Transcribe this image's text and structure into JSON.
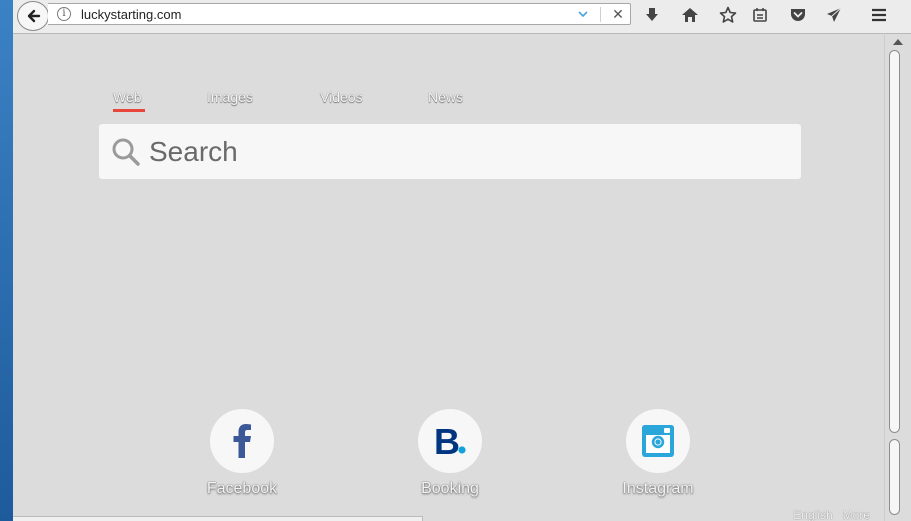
{
  "browser": {
    "url": "luckystarting.com",
    "toolbar_icons": [
      "download-icon",
      "home-icon",
      "bookmark-star-icon",
      "reading-list-icon",
      "pocket-icon",
      "send-icon",
      "menu-icon"
    ]
  },
  "page": {
    "tabs": [
      {
        "label": "Web",
        "active": true
      },
      {
        "label": "Images",
        "active": false
      },
      {
        "label": "Videos",
        "active": false
      },
      {
        "label": "News",
        "active": false
      }
    ],
    "search": {
      "placeholder": "Search"
    },
    "tiles": [
      {
        "label": "Facebook",
        "icon": "facebook-icon",
        "color": "#3b5998"
      },
      {
        "label": "Booking",
        "icon": "booking-icon",
        "color": "#003580"
      },
      {
        "label": "Instagram",
        "icon": "instagram-icon",
        "color": "#2aa6da"
      }
    ],
    "footer_right": [
      "English",
      "More"
    ]
  },
  "colors": {
    "active_tab_underline": "#e8463b",
    "page_background": "#dcdcdc"
  }
}
